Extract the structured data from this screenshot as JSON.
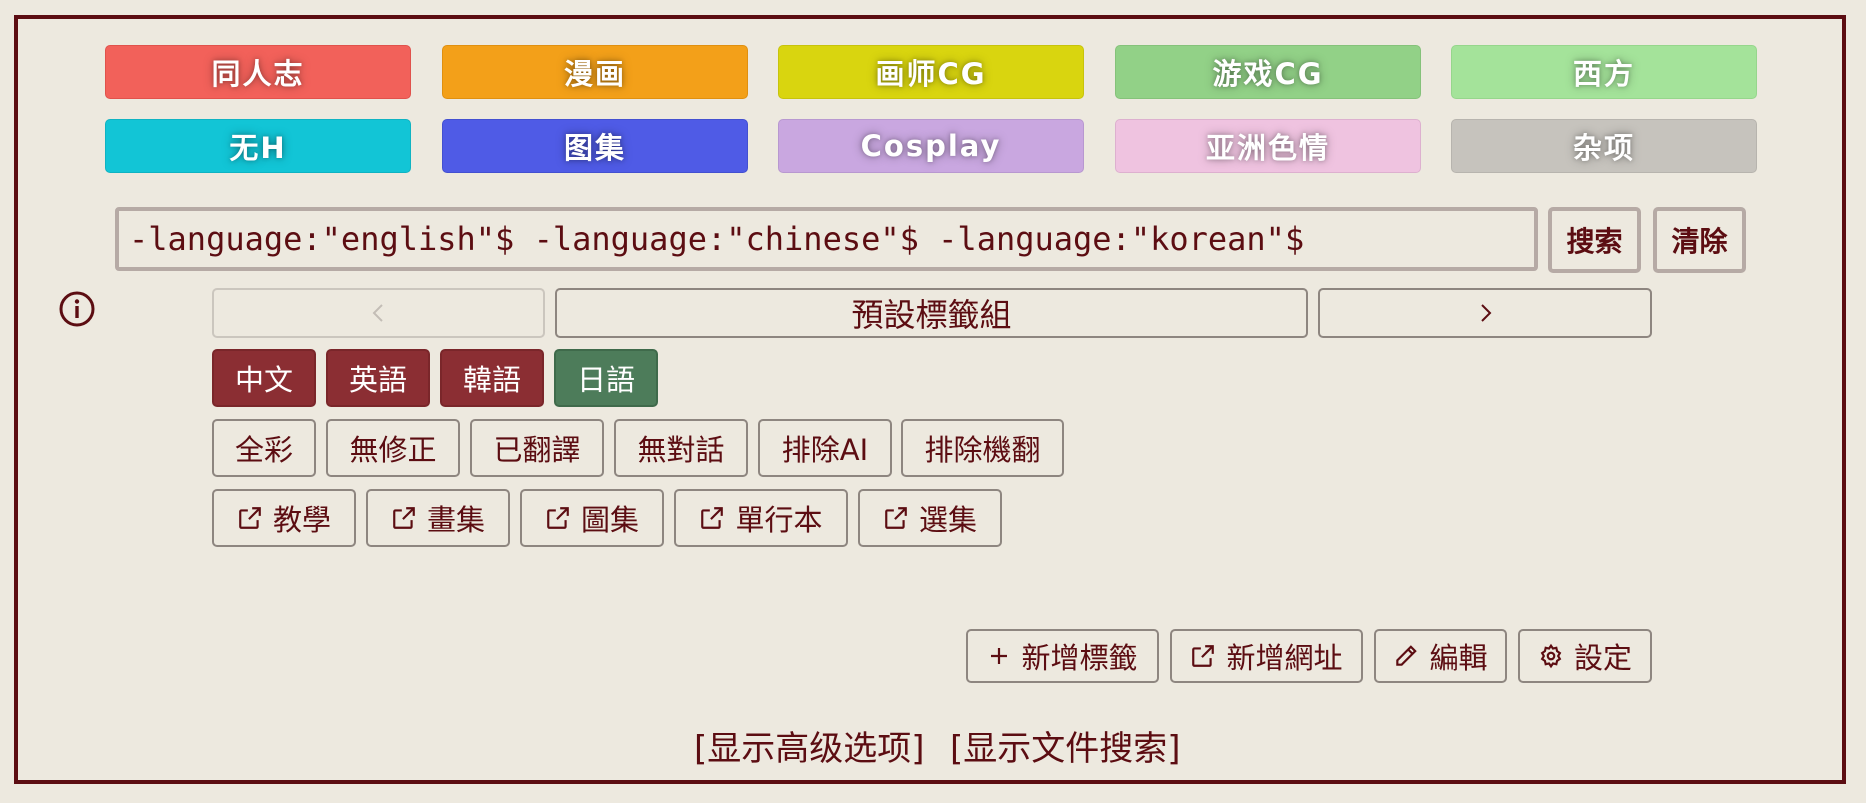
{
  "categories": [
    {
      "label": "同人志",
      "color": "#f2615a"
    },
    {
      "label": "漫画",
      "color": "#f3a019"
    },
    {
      "label": "画师CG",
      "color": "#d9d50f"
    },
    {
      "label": "游戏CG",
      "color": "#92d187"
    },
    {
      "label": "西方",
      "color": "#a4e39a"
    },
    {
      "label": "无H",
      "color": "#12c5d6"
    },
    {
      "label": "图集",
      "color": "#4f5be6"
    },
    {
      "label": "Cosplay",
      "color": "#c9a7e0"
    },
    {
      "label": "亚洲色情",
      "color": "#efc3e0"
    },
    {
      "label": "杂项",
      "color": "#c6c3bd"
    }
  ],
  "search": {
    "value": "-language:\"english\"$ -language:\"chinese\"$ -language:\"korean\"$",
    "search_label": "搜索",
    "clear_label": "清除"
  },
  "tag_nav": {
    "prev_icon": "chevron-left-icon",
    "title": "預設標籤組",
    "next_icon": "chevron-right-icon"
  },
  "language_tags": [
    {
      "label": "中文",
      "state": "excluded"
    },
    {
      "label": "英語",
      "state": "excluded"
    },
    {
      "label": "韓語",
      "state": "excluded"
    },
    {
      "label": "日語",
      "state": "included"
    }
  ],
  "filter_tags": [
    "全彩",
    "無修正",
    "已翻譯",
    "無對話",
    "排除AI",
    "排除機翻"
  ],
  "link_tags": [
    "教學",
    "畫集",
    "圖集",
    "單行本",
    "選集"
  ],
  "actions": {
    "add_tag": "新增標籤",
    "add_url": "新增網址",
    "edit": "編輯",
    "settings": "設定"
  },
  "footer": {
    "advanced": "[显示高级选项]",
    "file_search": "[显示文件搜索]"
  },
  "colors": {
    "accent": "#5c0d12",
    "background": "#ede9df",
    "excluded_tag": "#8b2e33",
    "included_tag": "#4d7c5a"
  }
}
